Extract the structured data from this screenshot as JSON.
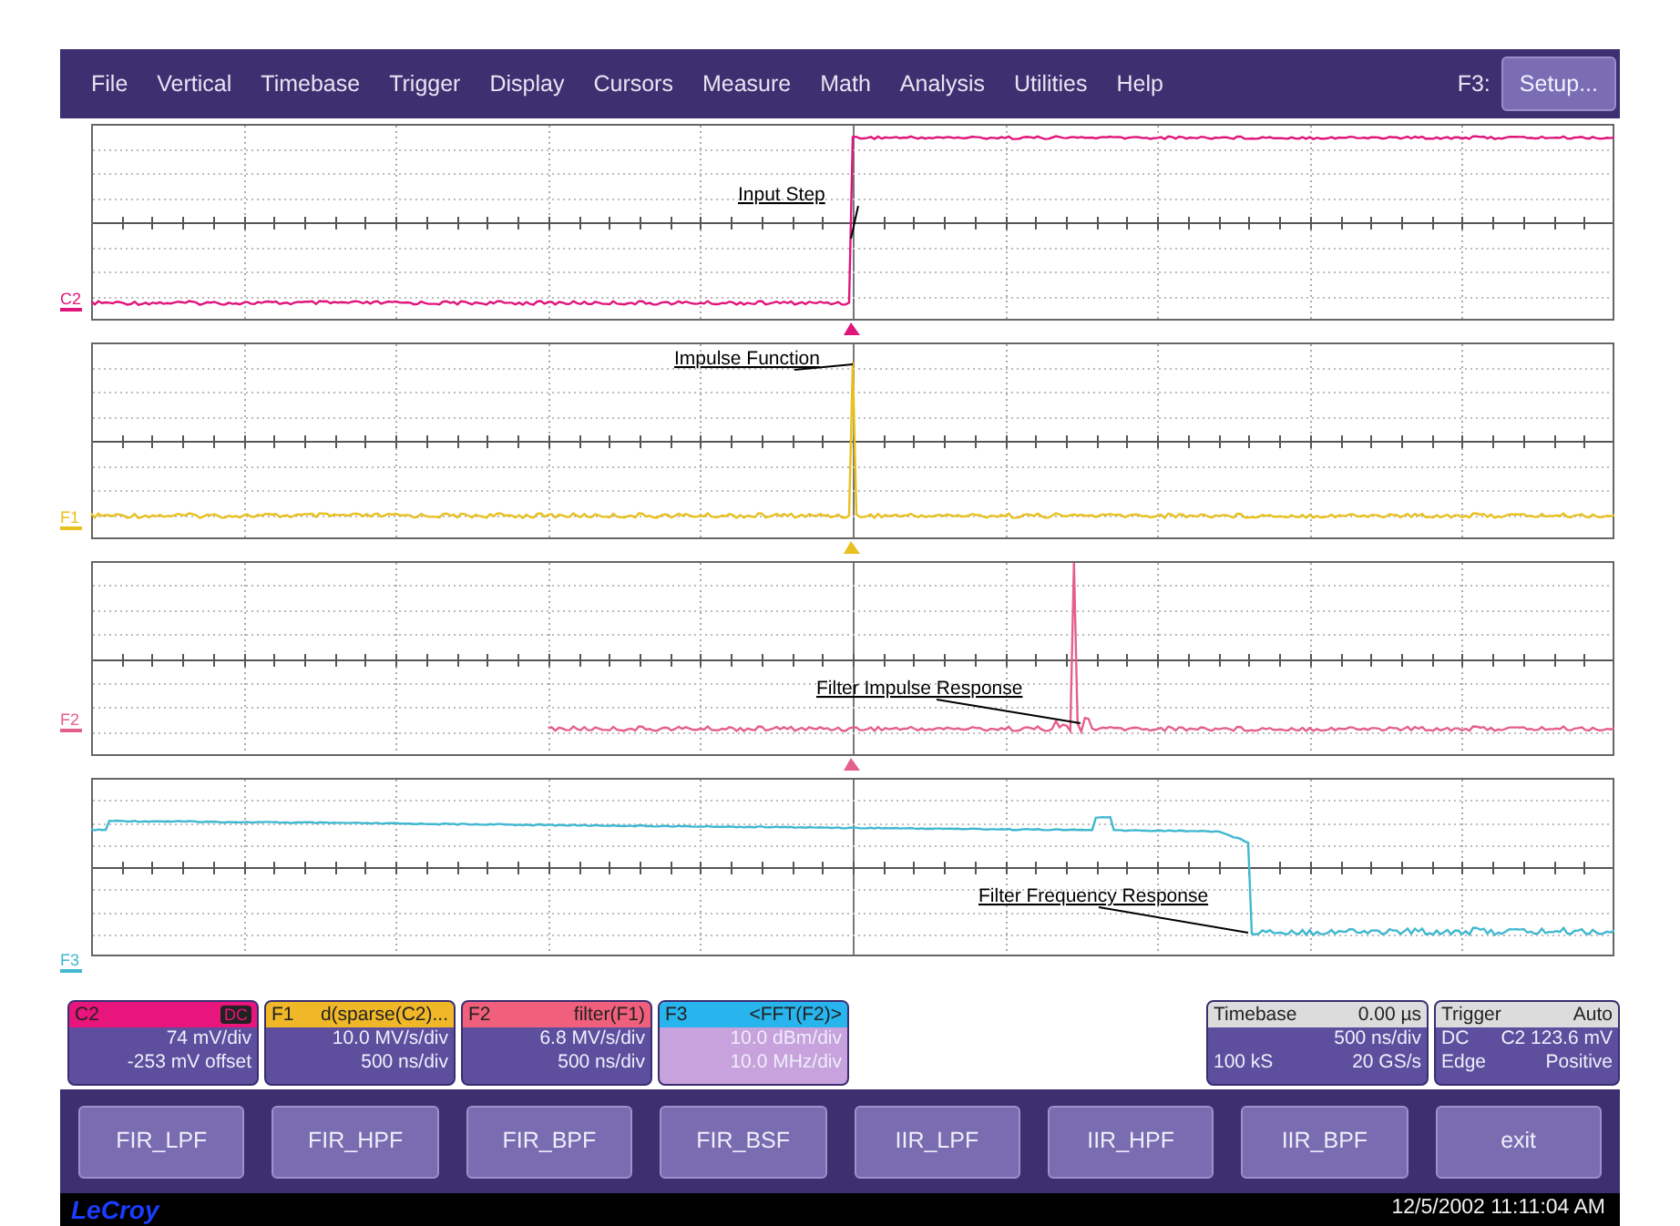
{
  "menu": {
    "items": [
      "File",
      "Vertical",
      "Timebase",
      "Trigger",
      "Display",
      "Cursors",
      "Measure",
      "Math",
      "Analysis",
      "Utilities",
      "Help"
    ],
    "shortcut_label": "F3:",
    "setup_button": "Setup..."
  },
  "traces": [
    {
      "label": "C2",
      "color": "#e0157c",
      "kind": "step",
      "annotation": "Input Step"
    },
    {
      "label": "F1",
      "color": "#e8c020",
      "kind": "impulse",
      "annotation": "Impulse Function"
    },
    {
      "label": "F2",
      "color": "#e4608a",
      "kind": "filter_impulse",
      "annotation": "Filter Impulse Response"
    },
    {
      "label": "F3",
      "color": "#40b8d0",
      "kind": "fft",
      "annotation": "Filter Frequency Response"
    }
  ],
  "descriptors": [
    {
      "name": "C2",
      "badge": "DC",
      "color": "#e8157c",
      "selected": false,
      "lines": [
        "74 mV/div",
        "-253 mV offset"
      ]
    },
    {
      "name": "F1",
      "function": "d(sparse(C2)...",
      "color": "#f0b828",
      "selected": false,
      "lines": [
        "10.0 MV/s/div",
        "500 ns/div"
      ]
    },
    {
      "name": "F2",
      "function": "filter(F1)",
      "color": "#f0607c",
      "selected": false,
      "lines": [
        "6.8 MV/s/div",
        "500 ns/div"
      ]
    },
    {
      "name": "F3",
      "function": "<FFT(F2)>",
      "color": "#28b4ec",
      "selected": true,
      "lines": [
        "10.0 dBm/div",
        "10.0 MHz/div"
      ]
    }
  ],
  "timebase": {
    "title": "Timebase",
    "value": "0.00 µs",
    "per_div": "500 ns/div",
    "samples": "100 kS",
    "rate": "20 GS/s"
  },
  "trigger": {
    "title": "Trigger",
    "mode": "Auto",
    "coupling": "DC",
    "level": "C2 123.6 mV",
    "type": "Edge",
    "slope": "Positive"
  },
  "buttons": [
    "FIR_LPF",
    "FIR_HPF",
    "FIR_BPF",
    "FIR_BSF",
    "IIR_LPF",
    "IIR_HPF",
    "IIR_BPF",
    "exit"
  ],
  "footer": {
    "logo": "LeCroy",
    "datetime": "12/5/2002 11:11:04 AM"
  }
}
